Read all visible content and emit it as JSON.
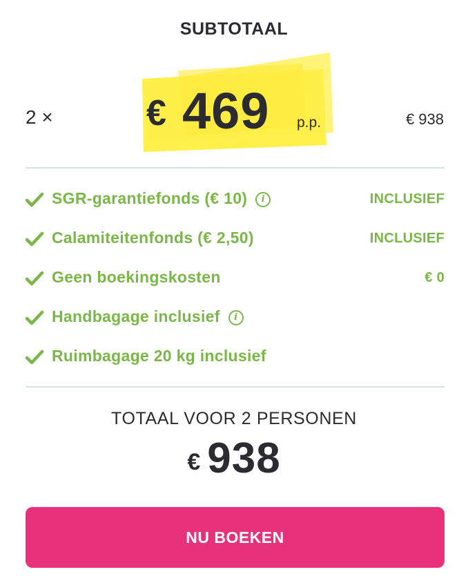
{
  "subtotal": {
    "title": "SUBTOTAAL",
    "quantity": "2 ×",
    "price_currency": "€",
    "price_amount": "469",
    "price_unit": "p.p.",
    "row_total": "€ 938",
    "highlight_color": "#fff04a"
  },
  "fees": [
    {
      "label": "SGR-garantiefonds  (€ 10)",
      "info": true,
      "value": "INCLUSIEF"
    },
    {
      "label": "Calamiteitenfonds  (€ 2,50)",
      "info": false,
      "value": "INCLUSIEF"
    },
    {
      "label": "Geen boekingskosten",
      "info": false,
      "value": "€ 0"
    },
    {
      "label": "Handbagage inclusief",
      "info": true,
      "value": ""
    },
    {
      "label": "Ruimbagage 20 kg inclusief",
      "info": false,
      "value": ""
    }
  ],
  "icons": {
    "check": "check-icon",
    "info": "info-icon"
  },
  "info_glyph": "i",
  "total": {
    "title": "TOTAAL VOOR 2 PERSONEN",
    "currency": "€",
    "amount": "938"
  },
  "button": {
    "label": "NU BOEKEN"
  },
  "colors": {
    "accent_green": "#7ab648",
    "button_pink": "#e8317b",
    "text_dark": "#2b2b31"
  }
}
